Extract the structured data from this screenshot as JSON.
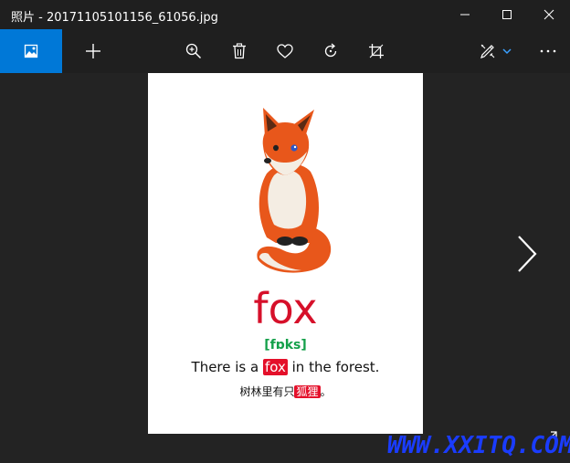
{
  "window": {
    "title": "照片 - 20171105101156_61056.jpg"
  },
  "toolbar": {
    "items": [
      "image-icon",
      "plus-icon",
      "zoom-in-icon",
      "delete-icon",
      "heart-icon",
      "rotate-icon",
      "crop-icon",
      "edit-icon",
      "chevron-down-icon",
      "more-icon"
    ],
    "accent": "#0078d7"
  },
  "card": {
    "word": "fox",
    "phonetic": "[fɒks]",
    "sentence_before": "There is a ",
    "sentence_highlight": "fox",
    "sentence_after": " in the forest.",
    "cn_before": "树林里有只",
    "cn_highlight": "狐狸",
    "cn_after": "。",
    "word_color": "#d6102a",
    "phonetic_color": "#14a04a",
    "highlight_color": "#e4102a"
  },
  "watermark": {
    "text": "WWW.XXITQ.COM"
  }
}
